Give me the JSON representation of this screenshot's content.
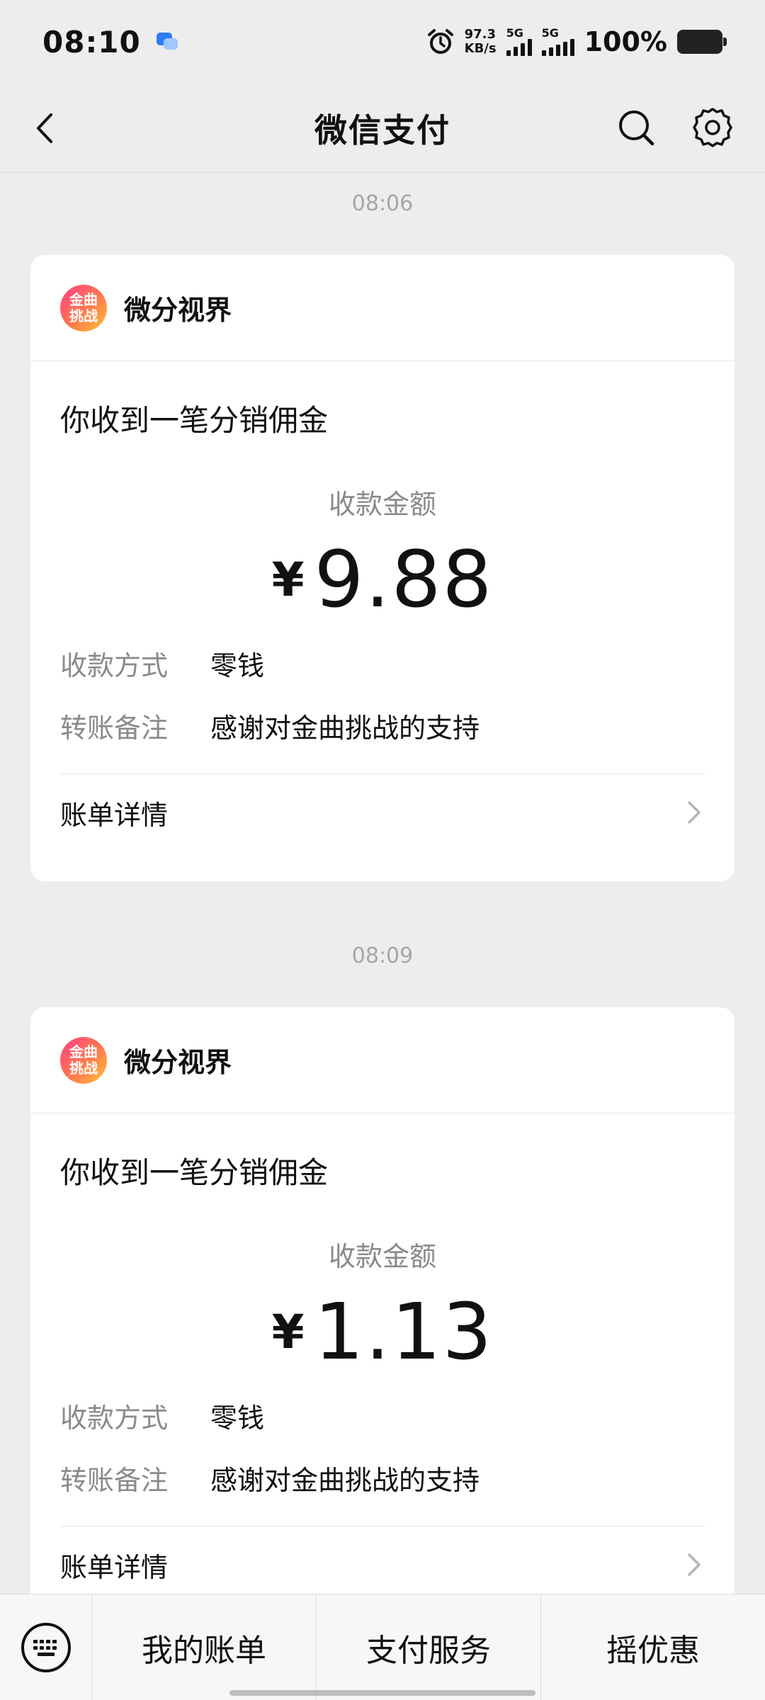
{
  "status_bar": {
    "time": "08:10",
    "net_speed_value": "97.3",
    "net_speed_unit": "KB/s",
    "signal1_label": "5G",
    "signal2_label": "5G",
    "battery": "100%"
  },
  "nav": {
    "title": "微信支付"
  },
  "messages": [
    {
      "timestamp": "08:06",
      "merchant": "微分视界",
      "avatar_line1": "金曲",
      "avatar_line2": "挑战",
      "title": "你收到一笔分销佣金",
      "amount_label": "收款金额",
      "currency": "¥",
      "amount": "9.88",
      "method_label": "收款方式",
      "method_value": "零钱",
      "note_label": "转账备注",
      "note_value": "感谢对金曲挑战的支持",
      "detail_label": "账单详情"
    },
    {
      "timestamp": "08:09",
      "merchant": "微分视界",
      "avatar_line1": "金曲",
      "avatar_line2": "挑战",
      "title": "你收到一笔分销佣金",
      "amount_label": "收款金额",
      "currency": "¥",
      "amount": "1.13",
      "method_label": "收款方式",
      "method_value": "零钱",
      "note_label": "转账备注",
      "note_value": "感谢对金曲挑战的支持",
      "detail_label": "账单详情"
    }
  ],
  "bottom_bar": {
    "items": [
      "我的账单",
      "支付服务",
      "摇优惠"
    ]
  },
  "colors": {
    "background": "#ededed",
    "card": "#ffffff",
    "secondary_text": "#8a8a8a",
    "timestamp": "#a6a6a6"
  }
}
